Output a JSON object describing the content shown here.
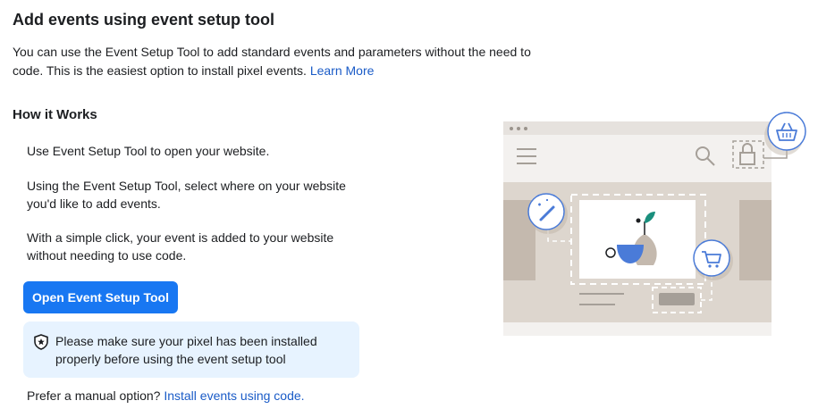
{
  "header": {
    "title": "Add events using event setup tool"
  },
  "intro": {
    "text": "You can use the Event Setup Tool to add standard events and parameters without the need to code. This is the easiest option to install pixel events.",
    "link": "Learn More"
  },
  "how_it_works": {
    "heading": "How it Works",
    "steps": [
      "Use Event Setup Tool to open your website.",
      "Using the Event Setup Tool, select where on your website you'd like to add events.",
      "With a simple click, your event is added to your website without needing to use code."
    ]
  },
  "primary_button": {
    "label": "Open Event Setup Tool"
  },
  "notice": {
    "icon": "shield-star-icon",
    "text": "Please make sure your pixel has been installed properly before using the event setup tool"
  },
  "manual": {
    "prefix": "Prefer a manual option?",
    "link": "Install events using code."
  },
  "illustration": {
    "icons": [
      "basket-icon",
      "magic-wand-icon",
      "cart-icon",
      "search-icon",
      "lock-icon",
      "hamburger-icon"
    ]
  },
  "colors": {
    "accent": "#1877f2",
    "link": "#1a5bc7",
    "notice_bg": "#e7f3ff",
    "illus_accent": "#4a7bd8",
    "illus_stone": "#ddd6ce"
  }
}
